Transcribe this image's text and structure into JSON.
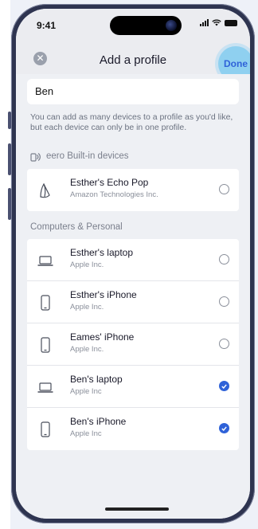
{
  "status_bar": {
    "time": "9:41"
  },
  "header": {
    "title": "Add a profile",
    "close_icon": "close-icon",
    "done_label": "Done"
  },
  "profile": {
    "name_value": "Ben"
  },
  "helper_text": "You can add as many devices to a profile as you'd like, but each device can only be in one profile.",
  "sections": [
    {
      "title": "eero Built-in devices",
      "icon": "eero-builtin-icon",
      "devices": [
        {
          "name": "Esther's Echo Pop",
          "maker": "Amazon Technologies Inc.",
          "icon": "echo-pop-icon",
          "selected": false
        }
      ]
    },
    {
      "title": "Computers & Personal",
      "devices": [
        {
          "name": "Esther's laptop",
          "maker": "Apple Inc.",
          "icon": "laptop-icon",
          "selected": false
        },
        {
          "name": "Esther's iPhone",
          "maker": "Apple Inc.",
          "icon": "phone-icon",
          "selected": false
        },
        {
          "name": "Eames' iPhone",
          "maker": "Apple Inc.",
          "icon": "phone-icon",
          "selected": false
        },
        {
          "name": "Ben's laptop",
          "maker": "Apple Inc",
          "icon": "laptop-icon",
          "selected": true
        },
        {
          "name": "Ben's iPhone",
          "maker": "Apple Inc",
          "icon": "phone-icon",
          "selected": true
        }
      ]
    }
  ],
  "colors": {
    "accent": "#2f62d8",
    "done_highlight": "#8fd0f0",
    "phone_frame": "#2e3450",
    "background": "#eef0f4"
  }
}
